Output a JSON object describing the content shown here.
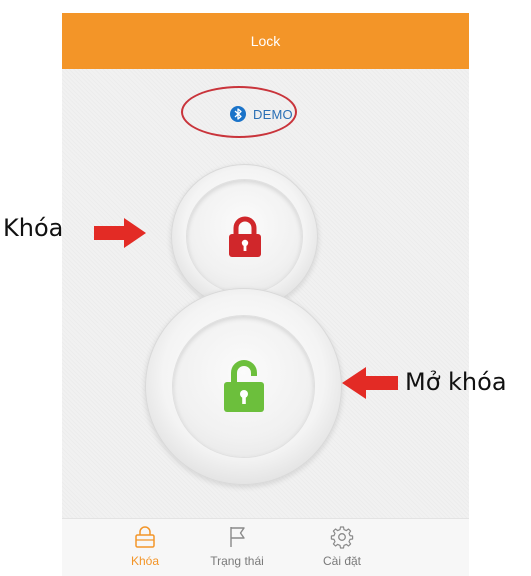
{
  "appbar": {
    "title": "Lock",
    "color": "#f39528"
  },
  "device": {
    "name": "DEMO",
    "icon": "bluetooth-icon"
  },
  "buttons": {
    "lock": {
      "icon": "locked-padlock-icon",
      "color": "#d0272b"
    },
    "unlock": {
      "icon": "unlocked-padlock-icon",
      "color": "#6cbf3c"
    }
  },
  "annotations": {
    "lock_label": "Khóa",
    "unlock_label": "Mở khóa"
  },
  "tabbar": {
    "items": [
      {
        "label": "Khóa",
        "icon": "lock-outline-icon",
        "active": true
      },
      {
        "label": "Trạng thái",
        "icon": "flag-icon",
        "active": false
      },
      {
        "label": "Cài đặt",
        "icon": "gear-icon",
        "active": false
      }
    ]
  }
}
